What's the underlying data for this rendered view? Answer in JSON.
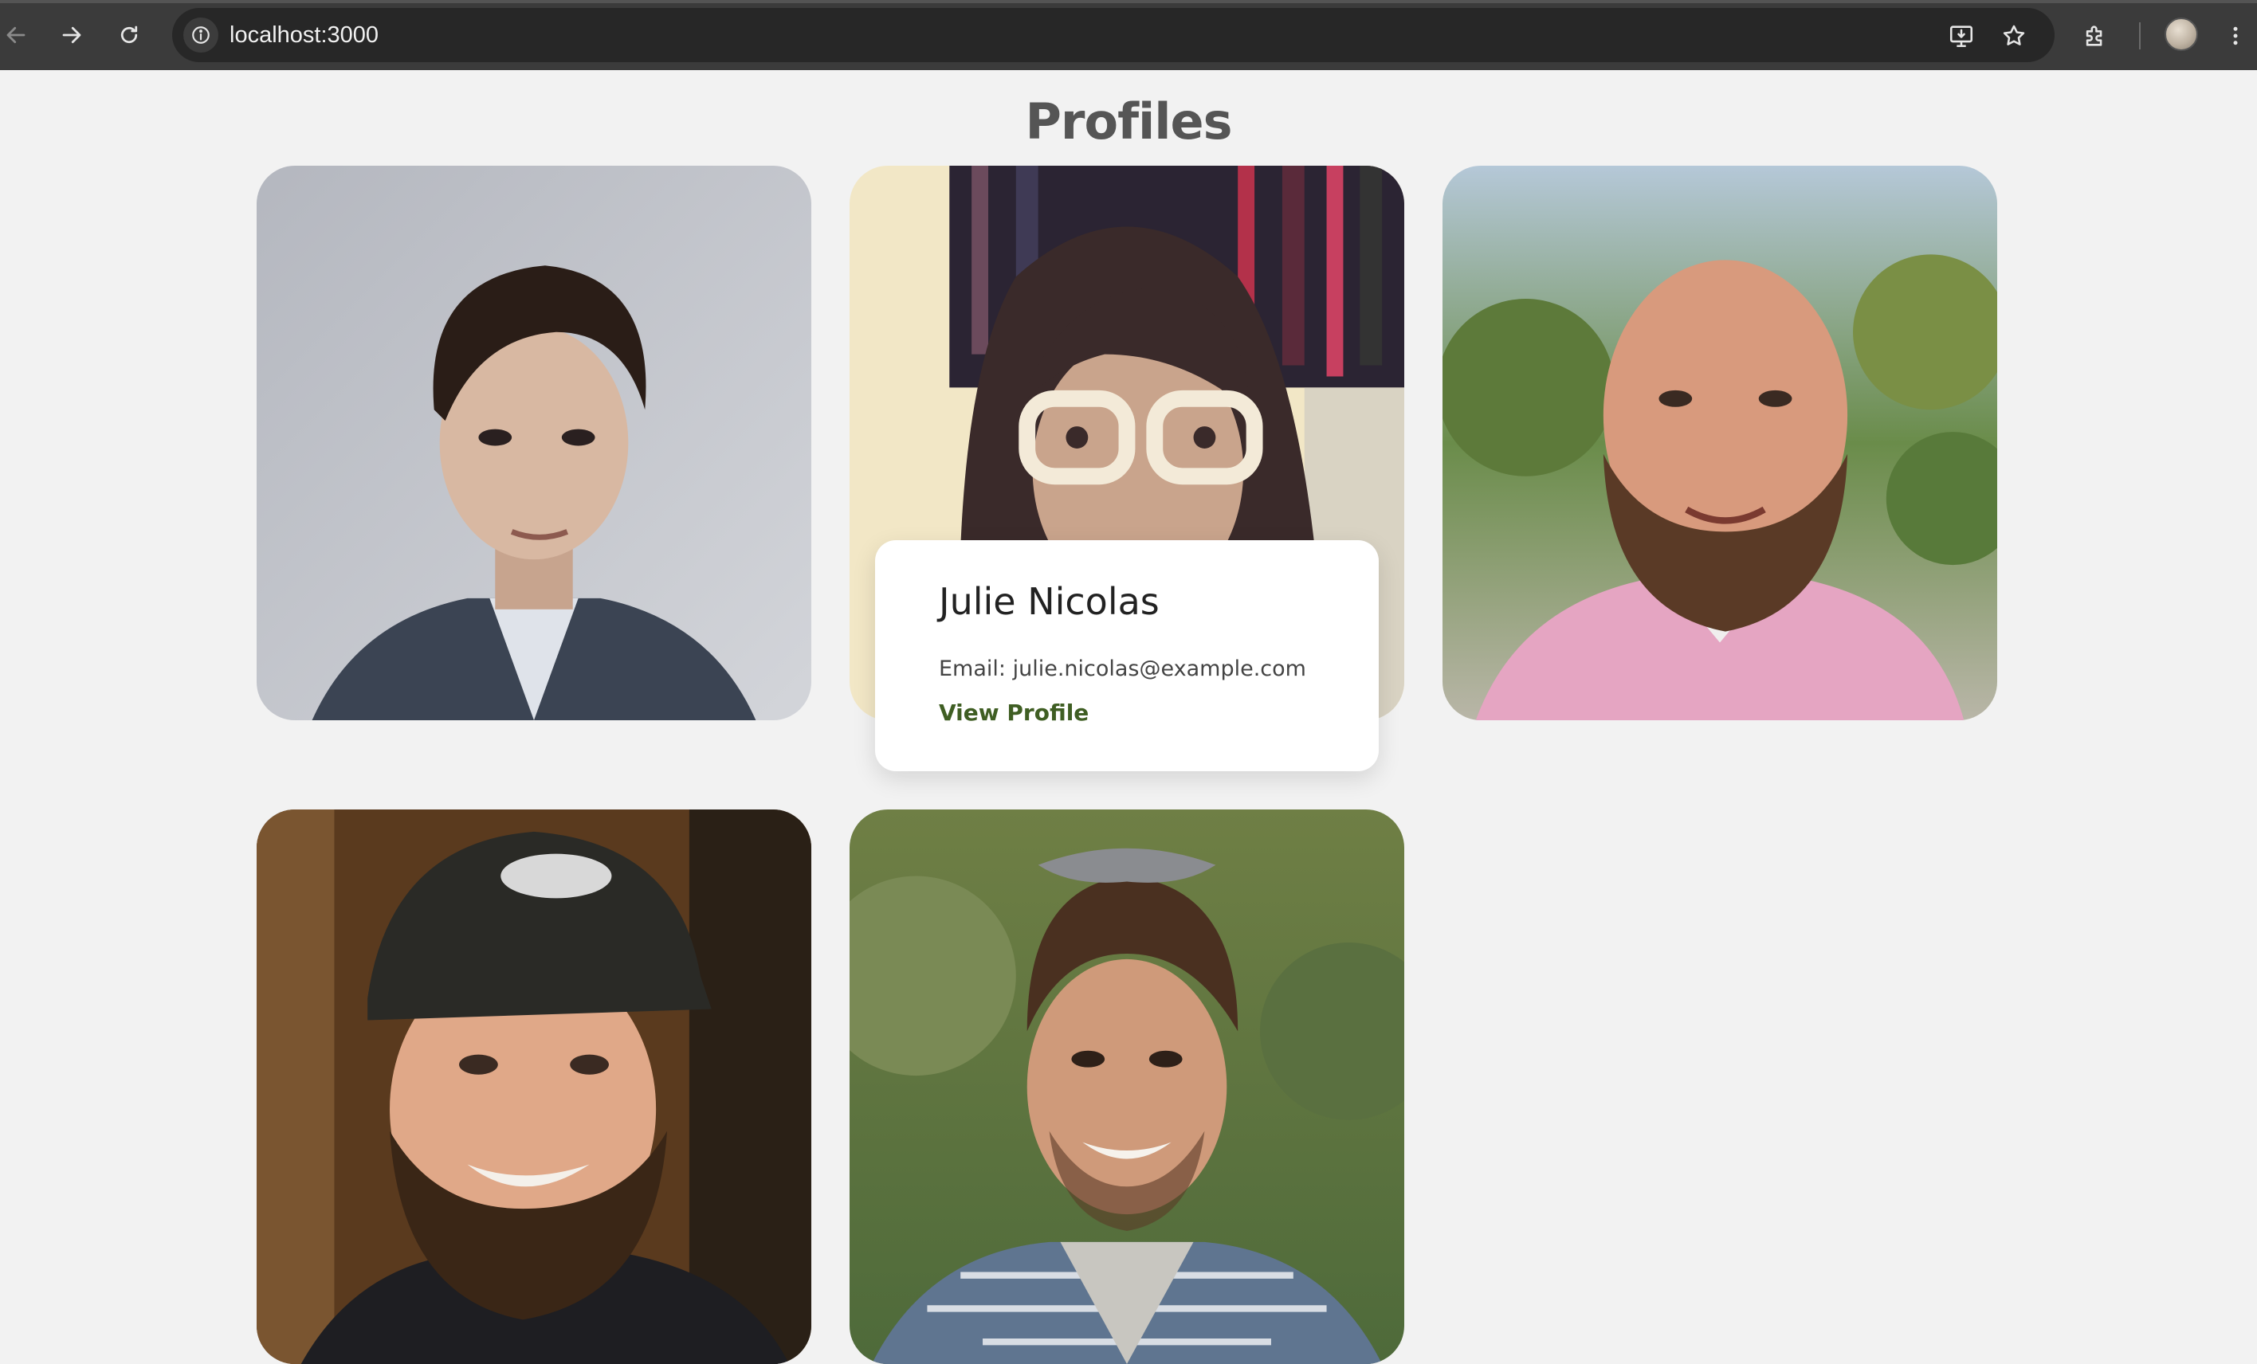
{
  "browser": {
    "url": "localhost:3000",
    "icons": [
      "back-arrow-icon",
      "forward-arrow-icon",
      "reload-icon",
      "site-info-icon",
      "install-app-icon",
      "bookmark-star-icon",
      "extensions-icon",
      "profile-avatar",
      "more-menu-icon"
    ]
  },
  "page": {
    "title": "Profiles"
  },
  "profiles": [
    {
      "photo": "young-man-dark-hair-suit"
    },
    {
      "photo": "woman-white-glasses-bookshelf"
    },
    {
      "photo": "bald-bearded-man-pink-shirt"
    },
    {
      "photo": "bearded-man-baseball-cap"
    },
    {
      "photo": "young-man-plaid-shirt-outdoors"
    }
  ],
  "hover_card": {
    "name": "Julie Nicolas",
    "email": "Email: julie.nicolas@example.com",
    "link_label": "View Profile"
  },
  "colors": {
    "page_background": "#f2f2f2",
    "title": "#555555",
    "link": "#3f5e23"
  }
}
